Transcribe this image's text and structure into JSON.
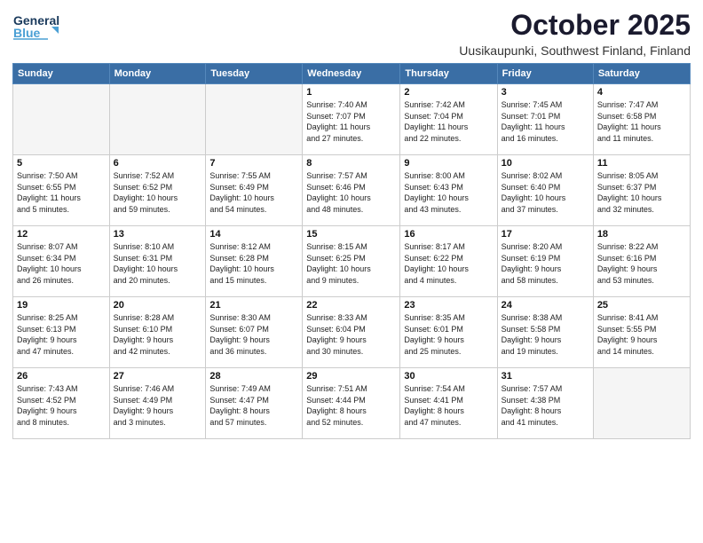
{
  "header": {
    "logo_general": "General",
    "logo_blue": "Blue",
    "month": "October 2025",
    "location": "Uusikaupunki, Southwest Finland, Finland"
  },
  "weekdays": [
    "Sunday",
    "Monday",
    "Tuesday",
    "Wednesday",
    "Thursday",
    "Friday",
    "Saturday"
  ],
  "weeks": [
    [
      {
        "day": "",
        "info": ""
      },
      {
        "day": "",
        "info": ""
      },
      {
        "day": "",
        "info": ""
      },
      {
        "day": "1",
        "info": "Sunrise: 7:40 AM\nSunset: 7:07 PM\nDaylight: 11 hours\nand 27 minutes."
      },
      {
        "day": "2",
        "info": "Sunrise: 7:42 AM\nSunset: 7:04 PM\nDaylight: 11 hours\nand 22 minutes."
      },
      {
        "day": "3",
        "info": "Sunrise: 7:45 AM\nSunset: 7:01 PM\nDaylight: 11 hours\nand 16 minutes."
      },
      {
        "day": "4",
        "info": "Sunrise: 7:47 AM\nSunset: 6:58 PM\nDaylight: 11 hours\nand 11 minutes."
      }
    ],
    [
      {
        "day": "5",
        "info": "Sunrise: 7:50 AM\nSunset: 6:55 PM\nDaylight: 11 hours\nand 5 minutes."
      },
      {
        "day": "6",
        "info": "Sunrise: 7:52 AM\nSunset: 6:52 PM\nDaylight: 10 hours\nand 59 minutes."
      },
      {
        "day": "7",
        "info": "Sunrise: 7:55 AM\nSunset: 6:49 PM\nDaylight: 10 hours\nand 54 minutes."
      },
      {
        "day": "8",
        "info": "Sunrise: 7:57 AM\nSunset: 6:46 PM\nDaylight: 10 hours\nand 48 minutes."
      },
      {
        "day": "9",
        "info": "Sunrise: 8:00 AM\nSunset: 6:43 PM\nDaylight: 10 hours\nand 43 minutes."
      },
      {
        "day": "10",
        "info": "Sunrise: 8:02 AM\nSunset: 6:40 PM\nDaylight: 10 hours\nand 37 minutes."
      },
      {
        "day": "11",
        "info": "Sunrise: 8:05 AM\nSunset: 6:37 PM\nDaylight: 10 hours\nand 32 minutes."
      }
    ],
    [
      {
        "day": "12",
        "info": "Sunrise: 8:07 AM\nSunset: 6:34 PM\nDaylight: 10 hours\nand 26 minutes."
      },
      {
        "day": "13",
        "info": "Sunrise: 8:10 AM\nSunset: 6:31 PM\nDaylight: 10 hours\nand 20 minutes."
      },
      {
        "day": "14",
        "info": "Sunrise: 8:12 AM\nSunset: 6:28 PM\nDaylight: 10 hours\nand 15 minutes."
      },
      {
        "day": "15",
        "info": "Sunrise: 8:15 AM\nSunset: 6:25 PM\nDaylight: 10 hours\nand 9 minutes."
      },
      {
        "day": "16",
        "info": "Sunrise: 8:17 AM\nSunset: 6:22 PM\nDaylight: 10 hours\nand 4 minutes."
      },
      {
        "day": "17",
        "info": "Sunrise: 8:20 AM\nSunset: 6:19 PM\nDaylight: 9 hours\nand 58 minutes."
      },
      {
        "day": "18",
        "info": "Sunrise: 8:22 AM\nSunset: 6:16 PM\nDaylight: 9 hours\nand 53 minutes."
      }
    ],
    [
      {
        "day": "19",
        "info": "Sunrise: 8:25 AM\nSunset: 6:13 PM\nDaylight: 9 hours\nand 47 minutes."
      },
      {
        "day": "20",
        "info": "Sunrise: 8:28 AM\nSunset: 6:10 PM\nDaylight: 9 hours\nand 42 minutes."
      },
      {
        "day": "21",
        "info": "Sunrise: 8:30 AM\nSunset: 6:07 PM\nDaylight: 9 hours\nand 36 minutes."
      },
      {
        "day": "22",
        "info": "Sunrise: 8:33 AM\nSunset: 6:04 PM\nDaylight: 9 hours\nand 30 minutes."
      },
      {
        "day": "23",
        "info": "Sunrise: 8:35 AM\nSunset: 6:01 PM\nDaylight: 9 hours\nand 25 minutes."
      },
      {
        "day": "24",
        "info": "Sunrise: 8:38 AM\nSunset: 5:58 PM\nDaylight: 9 hours\nand 19 minutes."
      },
      {
        "day": "25",
        "info": "Sunrise: 8:41 AM\nSunset: 5:55 PM\nDaylight: 9 hours\nand 14 minutes."
      }
    ],
    [
      {
        "day": "26",
        "info": "Sunrise: 7:43 AM\nSunset: 4:52 PM\nDaylight: 9 hours\nand 8 minutes."
      },
      {
        "day": "27",
        "info": "Sunrise: 7:46 AM\nSunset: 4:49 PM\nDaylight: 9 hours\nand 3 minutes."
      },
      {
        "day": "28",
        "info": "Sunrise: 7:49 AM\nSunset: 4:47 PM\nDaylight: 8 hours\nand 57 minutes."
      },
      {
        "day": "29",
        "info": "Sunrise: 7:51 AM\nSunset: 4:44 PM\nDaylight: 8 hours\nand 52 minutes."
      },
      {
        "day": "30",
        "info": "Sunrise: 7:54 AM\nSunset: 4:41 PM\nDaylight: 8 hours\nand 47 minutes."
      },
      {
        "day": "31",
        "info": "Sunrise: 7:57 AM\nSunset: 4:38 PM\nDaylight: 8 hours\nand 41 minutes."
      },
      {
        "day": "",
        "info": ""
      }
    ]
  ]
}
